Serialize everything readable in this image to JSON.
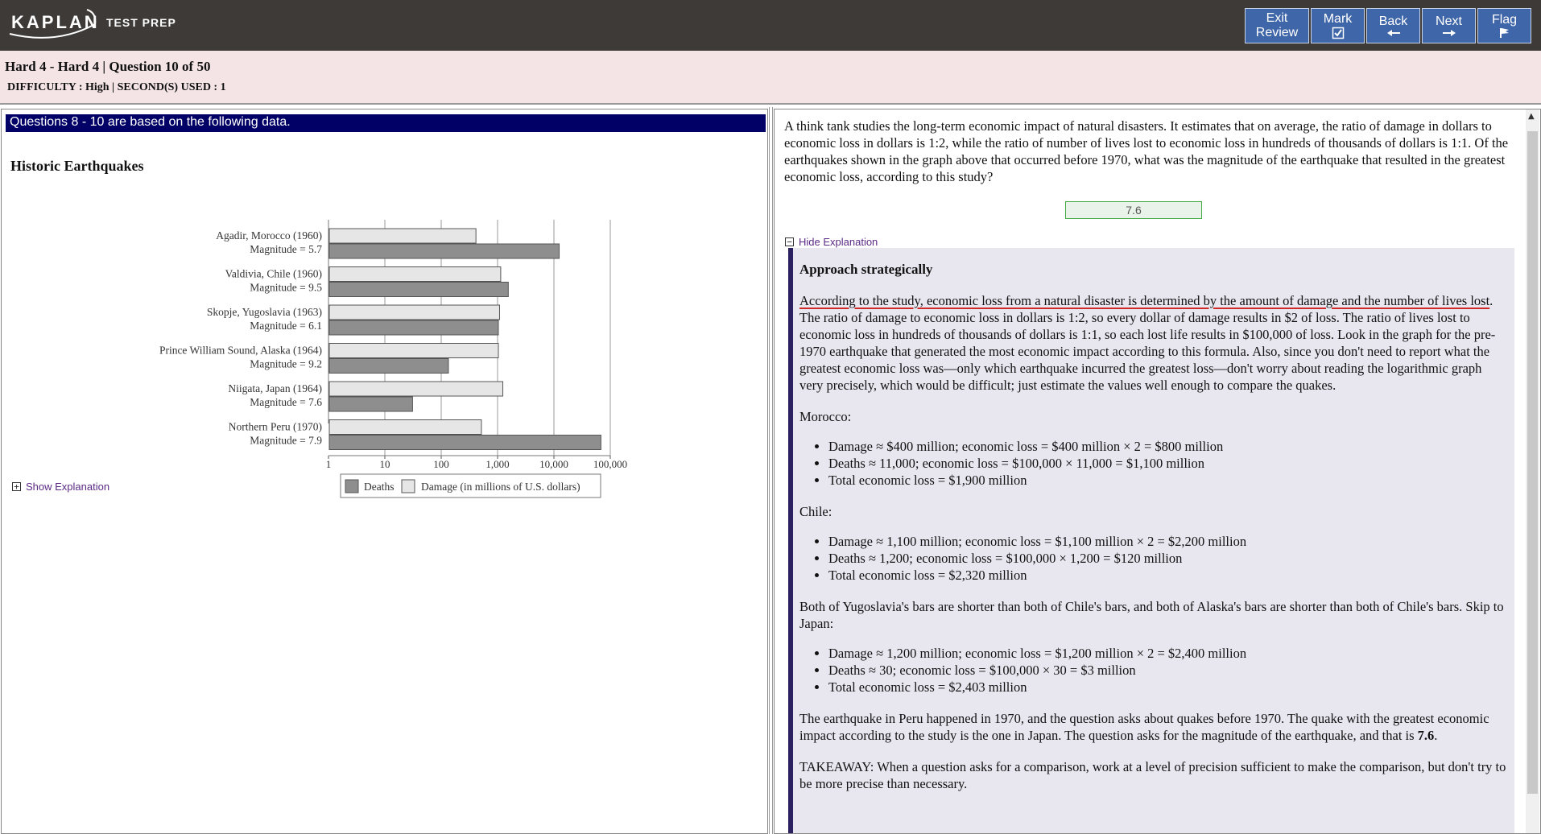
{
  "app": {
    "logo": "KAPLAN",
    "logo_sub": "TEST PREP"
  },
  "nav": {
    "exit_review": [
      "Exit",
      "Review"
    ],
    "mark": "Mark",
    "back": "Back",
    "next": "Next",
    "flag": "Flag"
  },
  "header": {
    "title": "Hard 4 - Hard 4 | Question  10 of 50",
    "difficulty": "DIFFICULTY : High | SECOND(S) USED : 1"
  },
  "left": {
    "passage_header": "Questions 8 - 10 are based on the following data.",
    "show_explanation": "Show Explanation"
  },
  "chart_data": {
    "type": "bar",
    "orientation": "horizontal",
    "x_scale": "log",
    "title": "Historic Earthquakes",
    "xlim": [
      1,
      100000
    ],
    "x_ticks": [
      "1",
      "10",
      "100",
      "1,000",
      "10,000",
      "100,000"
    ],
    "categories": [
      [
        "Agadir, Morocco (1960)",
        "Magnitude = 5.7"
      ],
      [
        "Valdivia, Chile (1960)",
        "Magnitude = 9.5"
      ],
      [
        "Skopje, Yugoslavia (1963)",
        "Magnitude = 6.1"
      ],
      [
        "Prince William Sound, Alaska (1964)",
        "Magnitude = 9.2"
      ],
      [
        "Niigata, Japan (1964)",
        "Magnitude = 7.6"
      ],
      [
        "Northern Peru (1970)",
        "Magnitude = 7.9"
      ]
    ],
    "series": [
      {
        "name": "Damage (in millions of U.S. dollars)",
        "color": "#e6e6e6",
        "values": [
          400,
          1100,
          1050,
          1000,
          1200,
          500
        ]
      },
      {
        "name": "Deaths",
        "color": "#8e8e8e",
        "values": [
          12000,
          1500,
          1000,
          130,
          30,
          66000
        ]
      }
    ],
    "legend": [
      "Deaths",
      "Damage (in millions of U.S. dollars)"
    ],
    "legend_position": "bottom"
  },
  "question": {
    "text": "A think tank studies the long-term economic impact of natural disasters.  It estimates that on average, the ratio of damage in dollars to economic loss in dollars is 1:2, while the ratio of number of lives lost to economic loss in hundreds of thousands of dollars is 1:1. Of the earthquakes shown in the graph above that occurred before 1970, what was the magnitude of the earthquake that resulted in the greatest economic loss, according to this study?",
    "answer": "7.6",
    "hide_explanation": "Hide Explanation"
  },
  "explanation": {
    "heading": "Approach strategically",
    "p1_highlight": "According to the study, economic loss from a natural disaster is determined by the amount of damage and the number of lives lost",
    "p1_rest": ". The ratio of damage to economic loss in dollars is 1:2, so every dollar of damage results in $2 of loss. The ratio of lives lost to economic loss in hundreds of thousands of dollars is 1:1, so each lost life results in $100,000 of loss. Look in the graph for the pre-1970 earthquake that generated the most economic impact according to this formula. Also, since you don't need to report what the greatest economic loss was—only which earthquake incurred the greatest loss—don't worry about reading the logarithmic graph very precisely, which would be difficult; just estimate the values well enough to compare the quakes.",
    "morocco_label": "Morocco:",
    "morocco": [
      "Damage ≈ $400 million; economic loss = $400 million × 2 = $800 million",
      "Deaths ≈ 11,000; economic loss = $100,000 × 11,000 = $1,100 million",
      "Total economic loss = $1,900 million"
    ],
    "chile_label": "Chile:",
    "chile": [
      "Damage ≈ 1,100 million; economic loss = $1,100 million × 2 = $2,200 million",
      "Deaths ≈ 1,200; economic loss = $100,000 × 1,200 = $120 million",
      "Total economic loss = $2,320 million"
    ],
    "both_text": "Both of Yugoslavia's bars are shorter than both of Chile's bars, and both of Alaska's bars are shorter than both of Chile's bars. Skip to Japan:",
    "japan": [
      "Damage ≈ 1,200 million; economic loss = $1,200 million × 2 = $2,400 million",
      "Deaths ≈ 30; economic loss = $100,000 × 30 = $3 million",
      "Total economic loss = $2,403 million"
    ],
    "peru_text_pre": "The earthquake in Peru happened in 1970, and the question asks about quakes before 1970. The quake with the greatest economic impact according to the study is the one in Japan. The question asks for the magnitude of the earthquake, and that is ",
    "peru_answer": "7.6",
    "peru_end": ".",
    "takeaway": "TAKEAWAY: When a question asks for a comparison, work at a level of precision sufficient to make the comparison, but don't try to be more precise than necessary."
  }
}
